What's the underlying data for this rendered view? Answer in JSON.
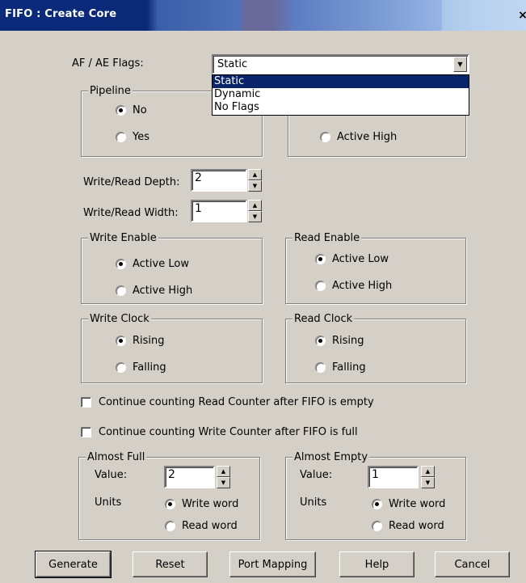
{
  "window": {
    "title": "FIFO : Create Core",
    "close_glyph": "×"
  },
  "flags": {
    "label": "AF / AE Flags:",
    "value": "Static",
    "options": [
      "Static",
      "Dynamic",
      "No Flags"
    ],
    "selected_index": 0
  },
  "pipeline": {
    "legend": "Pipeline",
    "options": [
      {
        "label": "No",
        "checked": true
      },
      {
        "label": "Yes",
        "checked": false
      }
    ]
  },
  "hidden_group": {
    "option_label": "Active High"
  },
  "depth": {
    "label": "Write/Read Depth:",
    "value": "2"
  },
  "width": {
    "label": "Write/Read Width:",
    "value": "1"
  },
  "write_enable": {
    "legend": "Write Enable",
    "options": [
      {
        "label": "Active Low",
        "checked": true
      },
      {
        "label": "Active High",
        "checked": false
      }
    ]
  },
  "read_enable": {
    "legend": "Read Enable",
    "options": [
      {
        "label": "Active Low",
        "checked": true
      },
      {
        "label": "Active High",
        "checked": false
      }
    ]
  },
  "write_clock": {
    "legend": "Write Clock",
    "options": [
      {
        "label": "Rising",
        "checked": true
      },
      {
        "label": "Falling",
        "checked": false
      }
    ]
  },
  "read_clock": {
    "legend": "Read Clock",
    "options": [
      {
        "label": "Rising",
        "checked": true
      },
      {
        "label": "Falling",
        "checked": false
      }
    ]
  },
  "checkboxes": {
    "read_counter": "Continue counting Read Counter after FIFO is empty",
    "write_counter": "Continue counting Write Counter after FIFO is full"
  },
  "almost_full": {
    "legend": "Almost Full",
    "value_label": "Value:",
    "value": "2",
    "units_label": "Units",
    "options": [
      {
        "label": "Write word",
        "checked": true
      },
      {
        "label": "Read word",
        "checked": false
      }
    ]
  },
  "almost_empty": {
    "legend": "Almost Empty",
    "value_label": "Value:",
    "value": "1",
    "units_label": "Units",
    "options": [
      {
        "label": "Write word",
        "checked": true
      },
      {
        "label": "Read word",
        "checked": false
      }
    ]
  },
  "buttons": {
    "generate": "Generate",
    "reset": "Reset",
    "port_mapping": "Port Mapping",
    "help": "Help",
    "cancel": "Cancel"
  },
  "icons": {
    "up_arrow": "▲",
    "down_arrow": "▼"
  }
}
